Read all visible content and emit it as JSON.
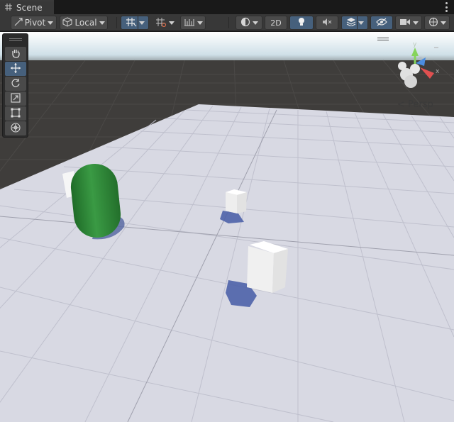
{
  "tab": {
    "title": "Scene",
    "icon": "grid-icon"
  },
  "toolbar": {
    "pivot_label": "Pivot",
    "local_label": "Local",
    "mode_2d_label": "2D"
  },
  "tools": [
    "hand-tool",
    "move-tool",
    "rotate-tool",
    "scale-tool",
    "rect-tool",
    "transform-tool"
  ],
  "active_tool": "move-tool",
  "gizmo": {
    "projection_label": "Persp",
    "axes": [
      "y",
      "x",
      "z"
    ]
  },
  "colors": {
    "capsule": "#2f8a3a",
    "cube": "#f4f4f4",
    "ground": "#d7d8e2",
    "shadow": "#4e5f9a",
    "active_button": "#46607c"
  }
}
